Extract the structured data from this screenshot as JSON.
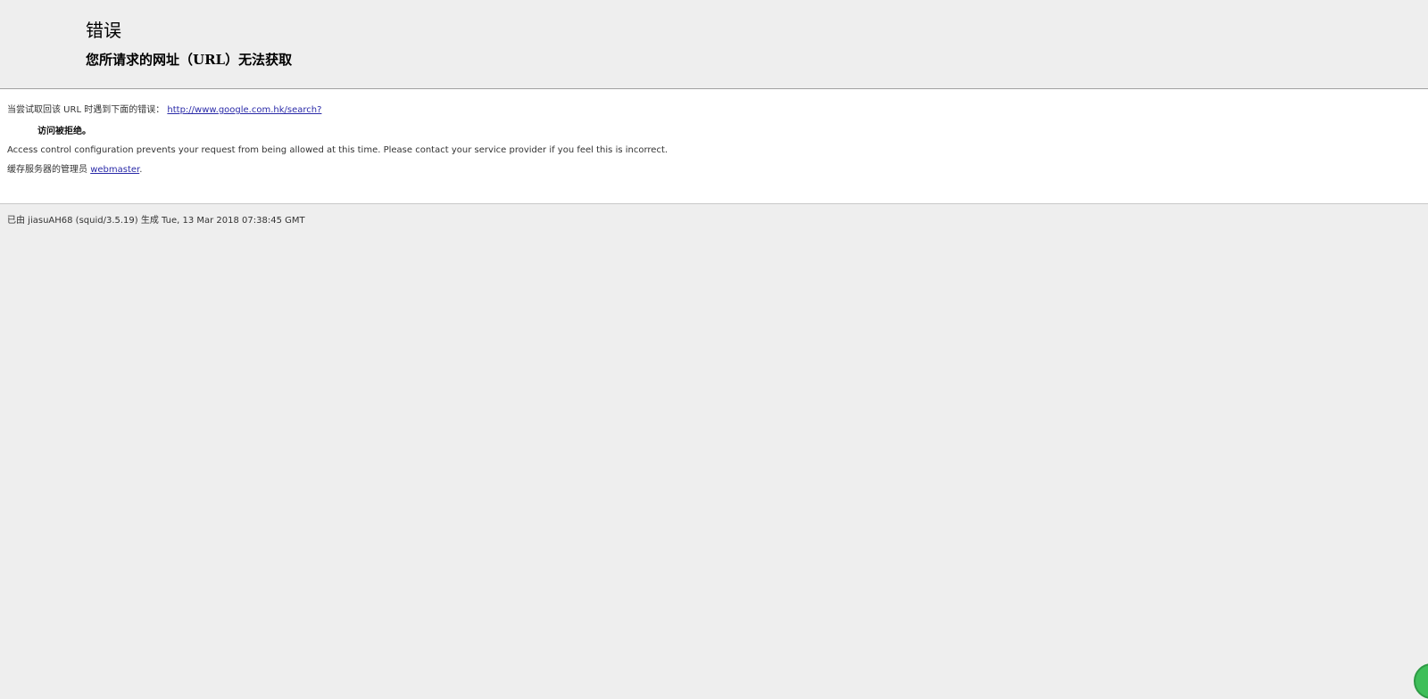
{
  "header": {
    "title": "错误",
    "subtitle": "您所请求的网址（URL）无法获取"
  },
  "content": {
    "intro_text": "当尝试取回该 URL 时遇到下面的错误：",
    "url_text": "http://www.google.com.hk/search?",
    "error_title": "访问被拒绝。",
    "description": "Access control configuration prevents your request from being allowed at this time. Please contact your service provider if you feel this is incorrect.",
    "admin_prefix": "缓存服务器的管理员 ",
    "admin_link": "webmaster",
    "admin_suffix": "."
  },
  "footer": {
    "text": "已由 jiasuAH68 (squid/3.5.19) 生成 Tue, 13 Mar 2018 07:38:45 GMT"
  },
  "colors": {
    "page_background": "#eeeeee",
    "content_background": "#ffffff",
    "link": "#2a2aa8",
    "badge": "#3fbf5a"
  }
}
